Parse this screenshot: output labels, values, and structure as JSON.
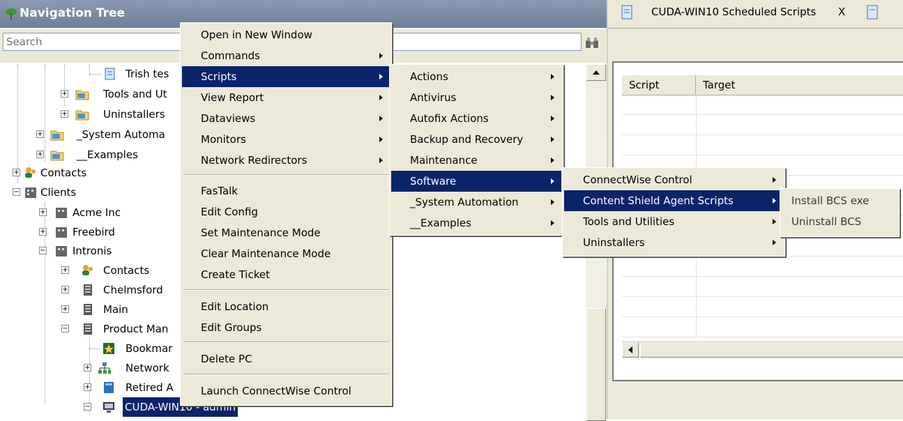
{
  "nav": {
    "title": "Navigation Tree",
    "search_placeholder": "Search",
    "tree": {
      "trish": "Trish tes",
      "tools": "Tools and Ut",
      "uninstallers": "Uninstallers",
      "sysauto": "_System Automa",
      "examples": "__Examples",
      "contacts": "Contacts",
      "clients": "Clients",
      "acme": "Acme Inc",
      "freebird": "Freebird",
      "intronis": "Intronis",
      "intronis_contacts": "Contacts",
      "chelmsford": "Chelmsford",
      "main": "Main",
      "product": "Product Man",
      "bookmark": "Bookmar",
      "network": "Network",
      "retired": "Retired A",
      "cuda": "CUDA-WIN10 - admin"
    }
  },
  "right": {
    "tab_title": "CUDA-WIN10 Scheduled Scripts",
    "tab_close": "X",
    "columns": [
      "Script",
      "Target"
    ]
  },
  "menu_main": {
    "items": [
      {
        "label": "Open in New Window"
      },
      {
        "label": "Commands"
      },
      {
        "label": "Scripts"
      },
      {
        "label": "View Report"
      },
      {
        "label": "Dataviews"
      },
      {
        "label": "Monitors"
      },
      {
        "label": "Network Redirectors"
      },
      {
        "label": "FasTalk"
      },
      {
        "label": "Edit Config"
      },
      {
        "label": "Set Maintenance Mode"
      },
      {
        "label": "Clear Maintenance Mode"
      },
      {
        "label": "Create Ticket"
      },
      {
        "label": "Edit Location"
      },
      {
        "label": "Edit Groups"
      },
      {
        "label": "Delete PC"
      },
      {
        "label": "Launch ConnectWise Control"
      }
    ]
  },
  "menu_scripts": {
    "items": [
      {
        "label": "Actions"
      },
      {
        "label": "Antivirus"
      },
      {
        "label": "Autofix Actions"
      },
      {
        "label": "Backup and Recovery"
      },
      {
        "label": "Maintenance"
      },
      {
        "label": "Software"
      },
      {
        "label": "_System Automation"
      },
      {
        "label": "__Examples"
      }
    ]
  },
  "menu_software": {
    "items": [
      {
        "label": "ConnectWise Control"
      },
      {
        "label": "Content Shield Agent Scripts"
      },
      {
        "label": "Tools and Utilities"
      },
      {
        "label": "Uninstallers"
      }
    ]
  },
  "menu_content_shield": {
    "items": [
      {
        "label": "Install BCS exe"
      },
      {
        "label": "Uninstall BCS"
      }
    ]
  },
  "colors": {
    "selection": "#0a246a",
    "menu_bg": "#ece9d8",
    "header": "#7b8ca6"
  }
}
